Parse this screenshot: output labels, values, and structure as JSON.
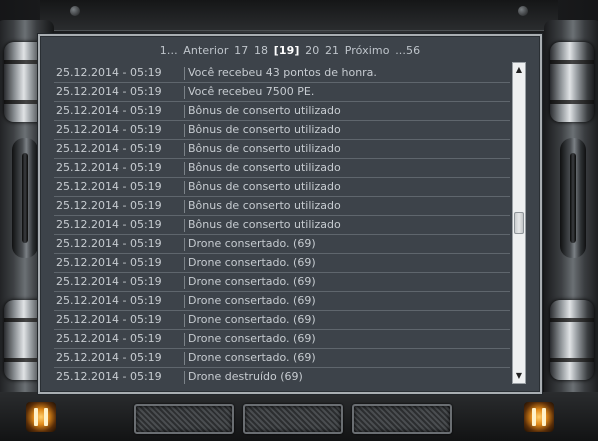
{
  "pagination": {
    "first": "1...",
    "prev": "Anterior",
    "pages": [
      "17",
      "18"
    ],
    "current": "[19]",
    "pages_after": [
      "20",
      "21"
    ],
    "next": "Próximo",
    "last": "...56"
  },
  "log": [
    {
      "date": "25.12.2014 - 05:19",
      "message": "Você recebeu 43 pontos de honra."
    },
    {
      "date": "25.12.2014 - 05:19",
      "message": "Você recebeu 7500 PE."
    },
    {
      "date": "25.12.2014 - 05:19",
      "message": "Bônus de conserto utilizado"
    },
    {
      "date": "25.12.2014 - 05:19",
      "message": "Bônus de conserto utilizado"
    },
    {
      "date": "25.12.2014 - 05:19",
      "message": "Bônus de conserto utilizado"
    },
    {
      "date": "25.12.2014 - 05:19",
      "message": "Bônus de conserto utilizado"
    },
    {
      "date": "25.12.2014 - 05:19",
      "message": "Bônus de conserto utilizado"
    },
    {
      "date": "25.12.2014 - 05:19",
      "message": "Bônus de conserto utilizado"
    },
    {
      "date": "25.12.2014 - 05:19",
      "message": "Bônus de conserto utilizado"
    },
    {
      "date": "25.12.2014 - 05:19",
      "message": "Drone consertado. (69)"
    },
    {
      "date": "25.12.2014 - 05:19",
      "message": "Drone consertado. (69)"
    },
    {
      "date": "25.12.2014 - 05:19",
      "message": "Drone consertado. (69)"
    },
    {
      "date": "25.12.2014 - 05:19",
      "message": "Drone consertado. (69)"
    },
    {
      "date": "25.12.2014 - 05:19",
      "message": "Drone consertado. (69)"
    },
    {
      "date": "25.12.2014 - 05:19",
      "message": "Drone consertado. (69)"
    },
    {
      "date": "25.12.2014 - 05:19",
      "message": "Drone consertado. (69)"
    },
    {
      "date": "25.12.2014 - 05:19",
      "message": "Drone destruído (69)"
    }
  ],
  "scrollbar": {
    "up_glyph": "▲",
    "down_glyph": "▼",
    "position_fraction": 0.5
  },
  "colors": {
    "panel_bg": "#3d434a",
    "text": "#c7ccd1",
    "accent_glow": "#e08a1a"
  }
}
